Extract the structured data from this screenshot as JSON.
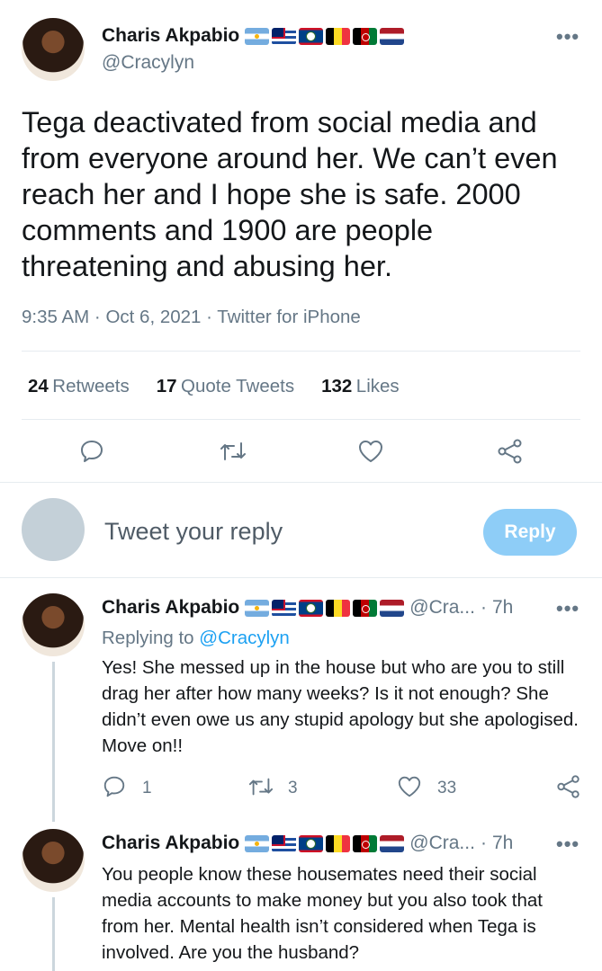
{
  "main_tweet": {
    "author_name": "Charis Akpabio",
    "author_handle": "@Cracylyn",
    "more": "•••",
    "text": "Tega deactivated from social media and from everyone around her. We can’t even reach her and I hope she is safe. 2000 comments and 1900 are people threatening and abusing her.",
    "time": "9:35 AM",
    "date": "Oct 6, 2021",
    "source": "Twitter for iPhone",
    "sep": "·",
    "retweets_count": "24",
    "retweets_label": "Retweets",
    "quote_count": "17",
    "quote_label": "Quote Tweets",
    "likes_count": "132",
    "likes_label": "Likes",
    "actions": [
      "comment-icon",
      "retweet-icon",
      "heart-icon",
      "share-icon"
    ]
  },
  "compose": {
    "placeholder": "Tweet your reply",
    "button_label": "Reply"
  },
  "flags": [
    "argentina",
    "british-indian-ocean-territory",
    "belize",
    "belgium",
    "afghanistan",
    "netherlands"
  ],
  "replies": [
    {
      "author_name": "Charis Akpabio",
      "author_handle": "@Cra...",
      "sep": "·",
      "age": "7h",
      "more": "•••",
      "replying_prefix": "Replying to",
      "replying_to": "@Cracylyn",
      "text": "Yes! She messed up in the house but who are you to still drag her after how many weeks? Is it not enough? She didn’t even owe us any stupid apology but she apologised. Move on!!",
      "reply_count": "1",
      "retweet_count": "3",
      "like_count": "33"
    },
    {
      "author_name": "Charis Akpabio",
      "author_handle": "@Cra...",
      "sep": "·",
      "age": "7h",
      "more": "•••",
      "text": "You people know these housemates need their social media accounts to make money but you also took that from her. Mental health isn’t considered when Tega is involved. Are you the husband?"
    }
  ]
}
